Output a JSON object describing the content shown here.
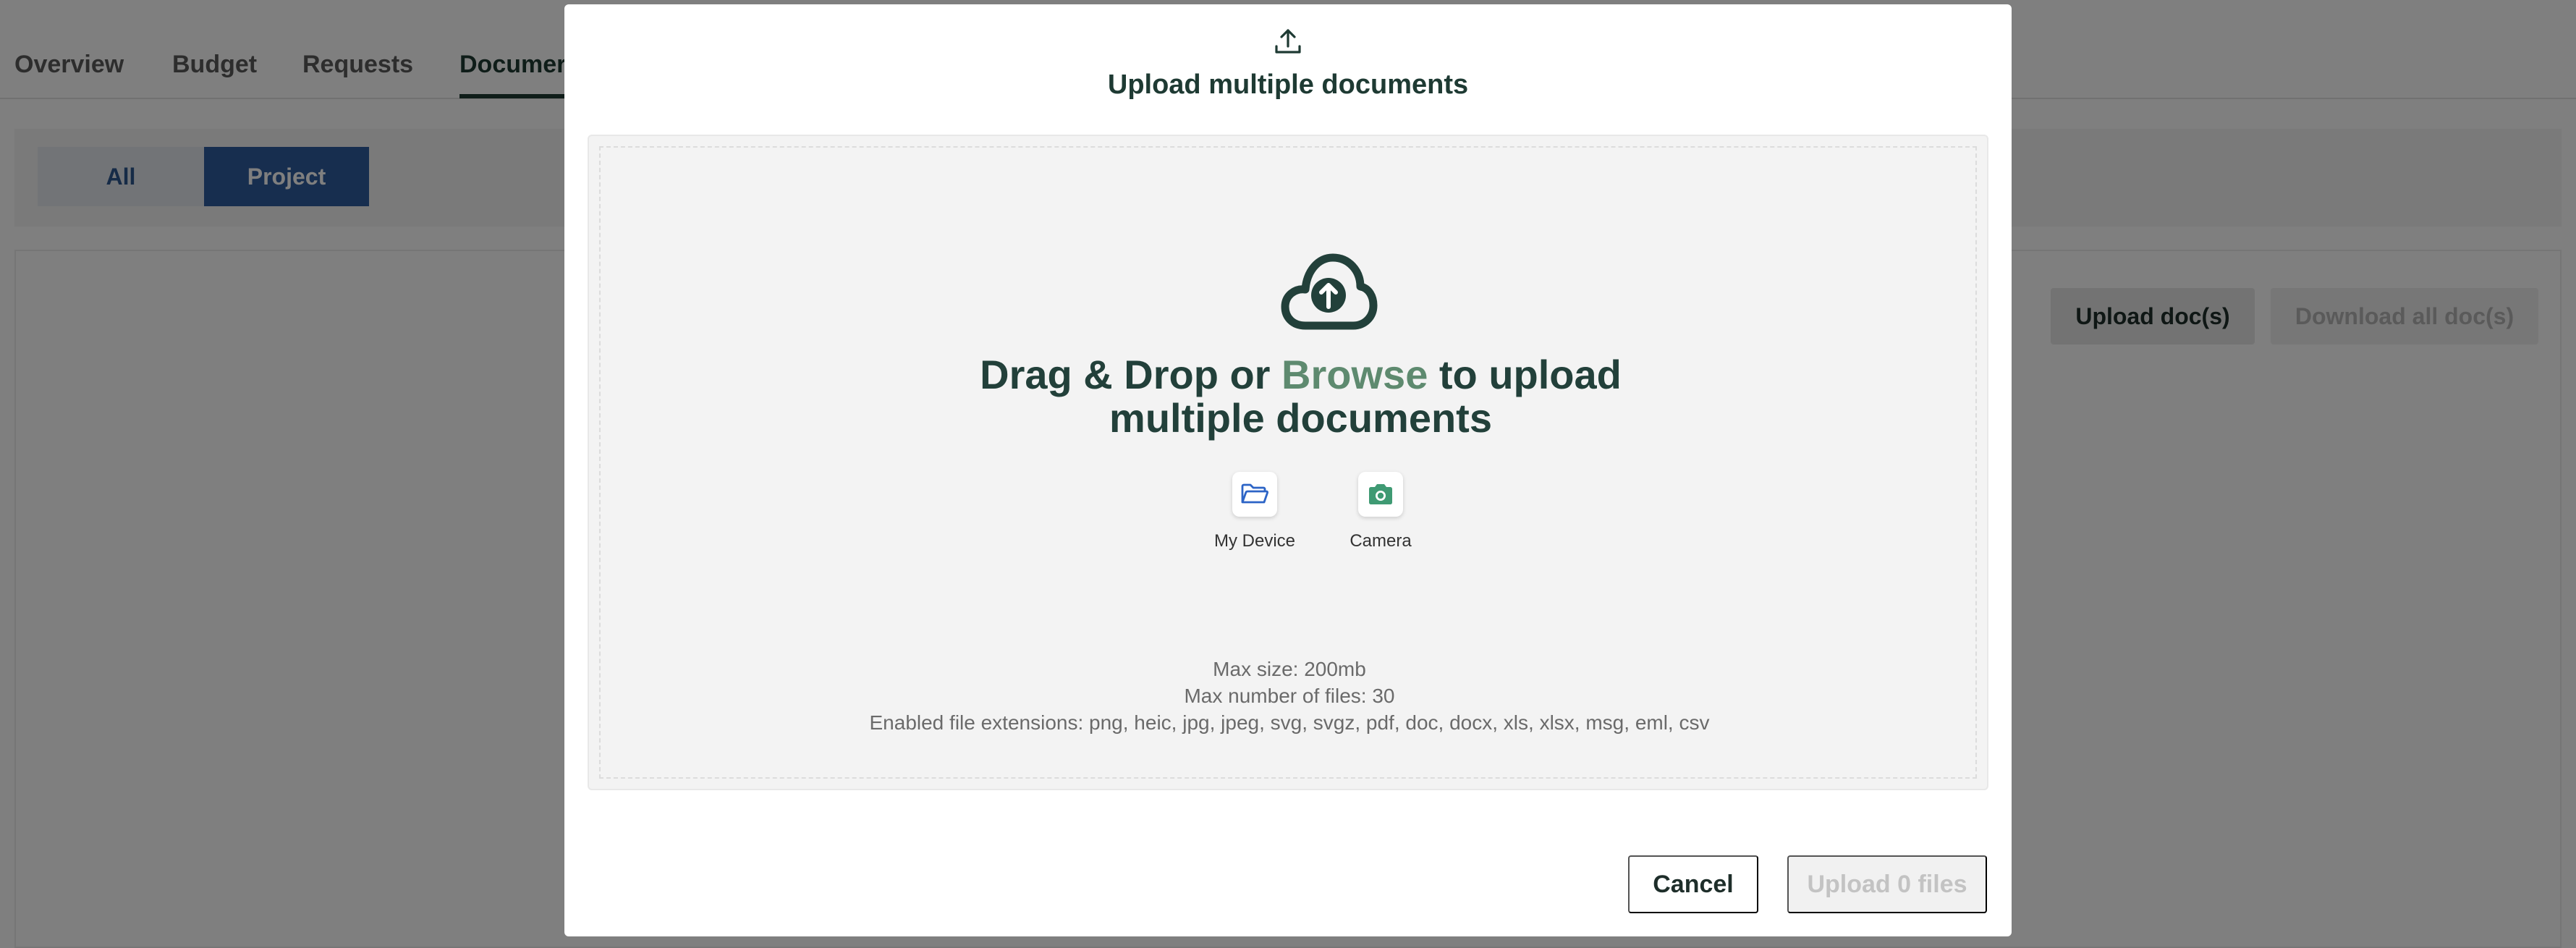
{
  "tabs": [
    {
      "label": "Overview"
    },
    {
      "label": "Budget"
    },
    {
      "label": "Requests"
    },
    {
      "label": "Documer"
    }
  ],
  "filters": {
    "all_label": "All",
    "project_label": "Project",
    "selected": "Project"
  },
  "actions": {
    "upload_label": "Upload doc(s)",
    "download_label": "Download all doc(s)"
  },
  "modal": {
    "title": "Upload multiple documents",
    "dropzone": {
      "text_before": "Drag & Drop or ",
      "browse_label": "Browse",
      "text_after": " to upload multiple documents",
      "sources": [
        {
          "label": "My Device",
          "icon": "folder-open-icon"
        },
        {
          "label": "Camera",
          "icon": "camera-icon"
        }
      ],
      "limits": [
        "Max size: 200mb",
        "Max number of files: 30",
        "Enabled file extensions: png, heic, jpg, jpeg, svg, svgz, pdf, doc, docx, xls, xlsx, msg, eml, csv"
      ]
    },
    "cancel_label": "Cancel",
    "submit_label": "Upload 0 files"
  },
  "colors": {
    "primary_dark": "#1e3a33",
    "browse_green": "#5e8a6f",
    "segment_blue": "#2f5d9e",
    "camera_green": "#3f9a73",
    "folder_blue": "#2c64c6"
  }
}
